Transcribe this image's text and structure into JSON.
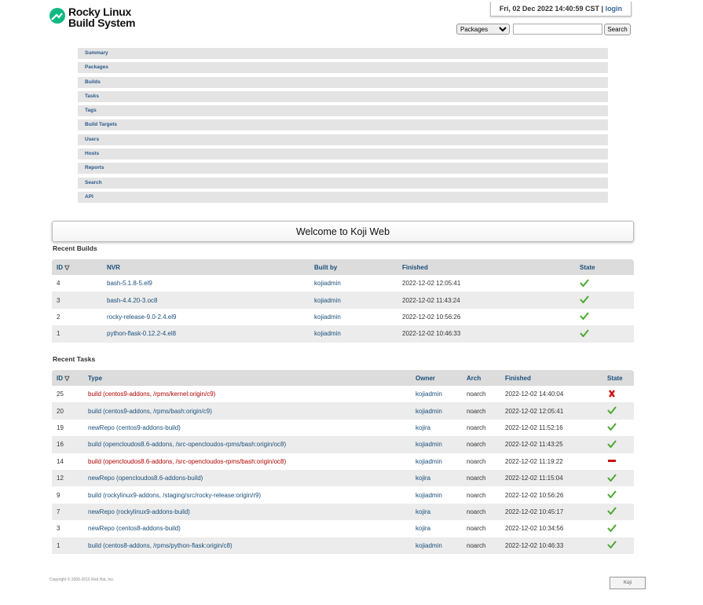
{
  "brand": {
    "line1": "Rocky Linux",
    "line2": "Build System"
  },
  "header": {
    "datetime": "Fri, 02 Dec 2022 14:40:59 CST",
    "separator": "|",
    "login_label": "login"
  },
  "search": {
    "type_selected": "Packages",
    "query": "",
    "button_label": "Search"
  },
  "nav": {
    "items": [
      "Summary",
      "Packages",
      "Builds",
      "Tasks",
      "Tags",
      "Build Targets",
      "Users",
      "Hosts",
      "Reports",
      "Search",
      "API"
    ]
  },
  "welcome": "Welcome to Koji Web",
  "recent_builds": {
    "title": "Recent Builds",
    "headers": {
      "id": "ID",
      "nvr": "NVR",
      "built_by": "Built by",
      "finished": "Finished",
      "state": "State"
    },
    "rows": [
      {
        "id": "4",
        "nvr": "bash-5.1.8-5.el9",
        "built_by": "kojiadmin",
        "finished": "2022-12-02 12:05:41",
        "state": "complete"
      },
      {
        "id": "3",
        "nvr": "bash-4.4.20-3.oc8",
        "built_by": "kojiadmin",
        "finished": "2022-12-02 11:43:24",
        "state": "complete"
      },
      {
        "id": "2",
        "nvr": "rocky-release-9.0-2.4.el9",
        "built_by": "kojiadmin",
        "finished": "2022-12-02 10:56:26",
        "state": "complete"
      },
      {
        "id": "1",
        "nvr": "python-flask-0.12.2-4.el8",
        "built_by": "kojiadmin",
        "finished": "2022-12-02 10:46:33",
        "state": "complete"
      }
    ]
  },
  "recent_tasks": {
    "title": "Recent Tasks",
    "headers": {
      "id": "ID",
      "type": "Type",
      "owner": "Owner",
      "arch": "Arch",
      "finished": "Finished",
      "state": "State"
    },
    "rows": [
      {
        "id": "25",
        "type": "build (centos9-addons, /rpms/kernel:origin/c9)",
        "owner": "kojiadmin",
        "arch": "noarch",
        "finished": "2022-12-02 14:40:04",
        "state": "failed"
      },
      {
        "id": "20",
        "type": "build (centos9-addons, /rpms/bash:origin/c9)",
        "owner": "kojiadmin",
        "arch": "noarch",
        "finished": "2022-12-02 12:05:41",
        "state": "closed"
      },
      {
        "id": "19",
        "type": "newRepo (centos9-addons-build)",
        "owner": "kojira",
        "arch": "noarch",
        "finished": "2022-12-02 11:52:16",
        "state": "closed"
      },
      {
        "id": "16",
        "type": "build (opencloudos8.6-addons, /src-opencloudos-rpms/bash:origin/oc8)",
        "owner": "kojiadmin",
        "arch": "noarch",
        "finished": "2022-12-02 11:43:25",
        "state": "closed"
      },
      {
        "id": "14",
        "type": "build (opencloudos8.6-addons, /src-opencloudos-rpms/bash:origin/oc8)",
        "owner": "kojiadmin",
        "arch": "noarch",
        "finished": "2022-12-02 11:19:22",
        "state": "canceled"
      },
      {
        "id": "12",
        "type": "newRepo (opencloudos8.6-addons-build)",
        "owner": "kojira",
        "arch": "noarch",
        "finished": "2022-12-02 11:15:04",
        "state": "closed"
      },
      {
        "id": "9",
        "type": "build (rockylinux9-addons, /staging/src/rocky-release:origin/r9)",
        "owner": "kojiadmin",
        "arch": "noarch",
        "finished": "2022-12-02 10:56:26",
        "state": "closed"
      },
      {
        "id": "7",
        "type": "newRepo (rockylinux9-addons-build)",
        "owner": "kojira",
        "arch": "noarch",
        "finished": "2022-12-02 10:45:17",
        "state": "closed"
      },
      {
        "id": "3",
        "type": "newRepo (centos8-addons-build)",
        "owner": "kojira",
        "arch": "noarch",
        "finished": "2022-12-02 10:34:56",
        "state": "closed"
      },
      {
        "id": "1",
        "type": "build (centos8-addons, /rpms/python-flask:origin/c8)",
        "owner": "kojiadmin",
        "arch": "noarch",
        "finished": "2022-12-02 10:46:33",
        "state": "closed"
      }
    ]
  },
  "footer": {
    "copyright": "Copyright © 2006-2016 Red Hat, Inc.",
    "powered_by": "Koji"
  },
  "colors": {
    "ok": "#4ca832",
    "failed": "#cc1111",
    "link": "#1a4f7a",
    "nav_bg": "#e4e4e4",
    "header_bg": "#dcdcdc"
  }
}
